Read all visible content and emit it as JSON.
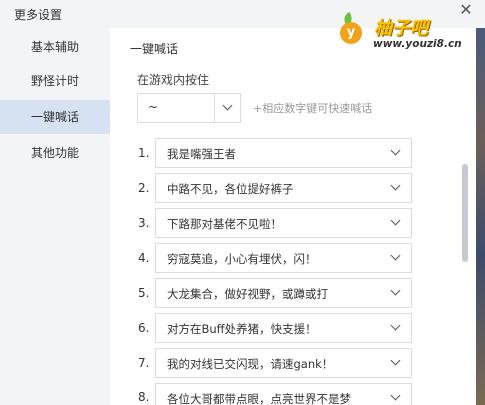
{
  "window": {
    "title": "更多设置",
    "close_glyph": "✕"
  },
  "logo": {
    "name": "柚子吧",
    "url": "www.youzi8.cn",
    "badge": "y"
  },
  "sidebar": {
    "items": [
      {
        "label": "基本辅助",
        "active": false
      },
      {
        "label": "野怪计时",
        "active": false
      },
      {
        "label": "一键喊话",
        "active": true
      },
      {
        "label": "其他功能",
        "active": false
      }
    ]
  },
  "main": {
    "section_title": "一键喊话",
    "hold_label": "在游戏内按住",
    "key_select": {
      "value": "~"
    },
    "hint": "+相应数字键可快速喊话",
    "phrases": [
      {
        "num": "1.",
        "text": "我是嘴强王者"
      },
      {
        "num": "2.",
        "text": "中路不见，各位提好裤子"
      },
      {
        "num": "3.",
        "text": "下路那对基佬不见啦！"
      },
      {
        "num": "4.",
        "text": "穷寇莫追，小心有埋伏，闪！"
      },
      {
        "num": "5.",
        "text": "大龙集合，做好视野，或蹲或打"
      },
      {
        "num": "6.",
        "text": "对方在Buff处养猪，快支援！"
      },
      {
        "num": "7.",
        "text": "我的对线已交闪现，请速gank！"
      },
      {
        "num": "8.",
        "text": "各位大哥都带点眼，点亮世界不是梦"
      }
    ]
  },
  "colors": {
    "sidebar_bg": "#f3f4f6",
    "active_item_bg": "#d6e1f1",
    "border": "#d9dde3"
  }
}
